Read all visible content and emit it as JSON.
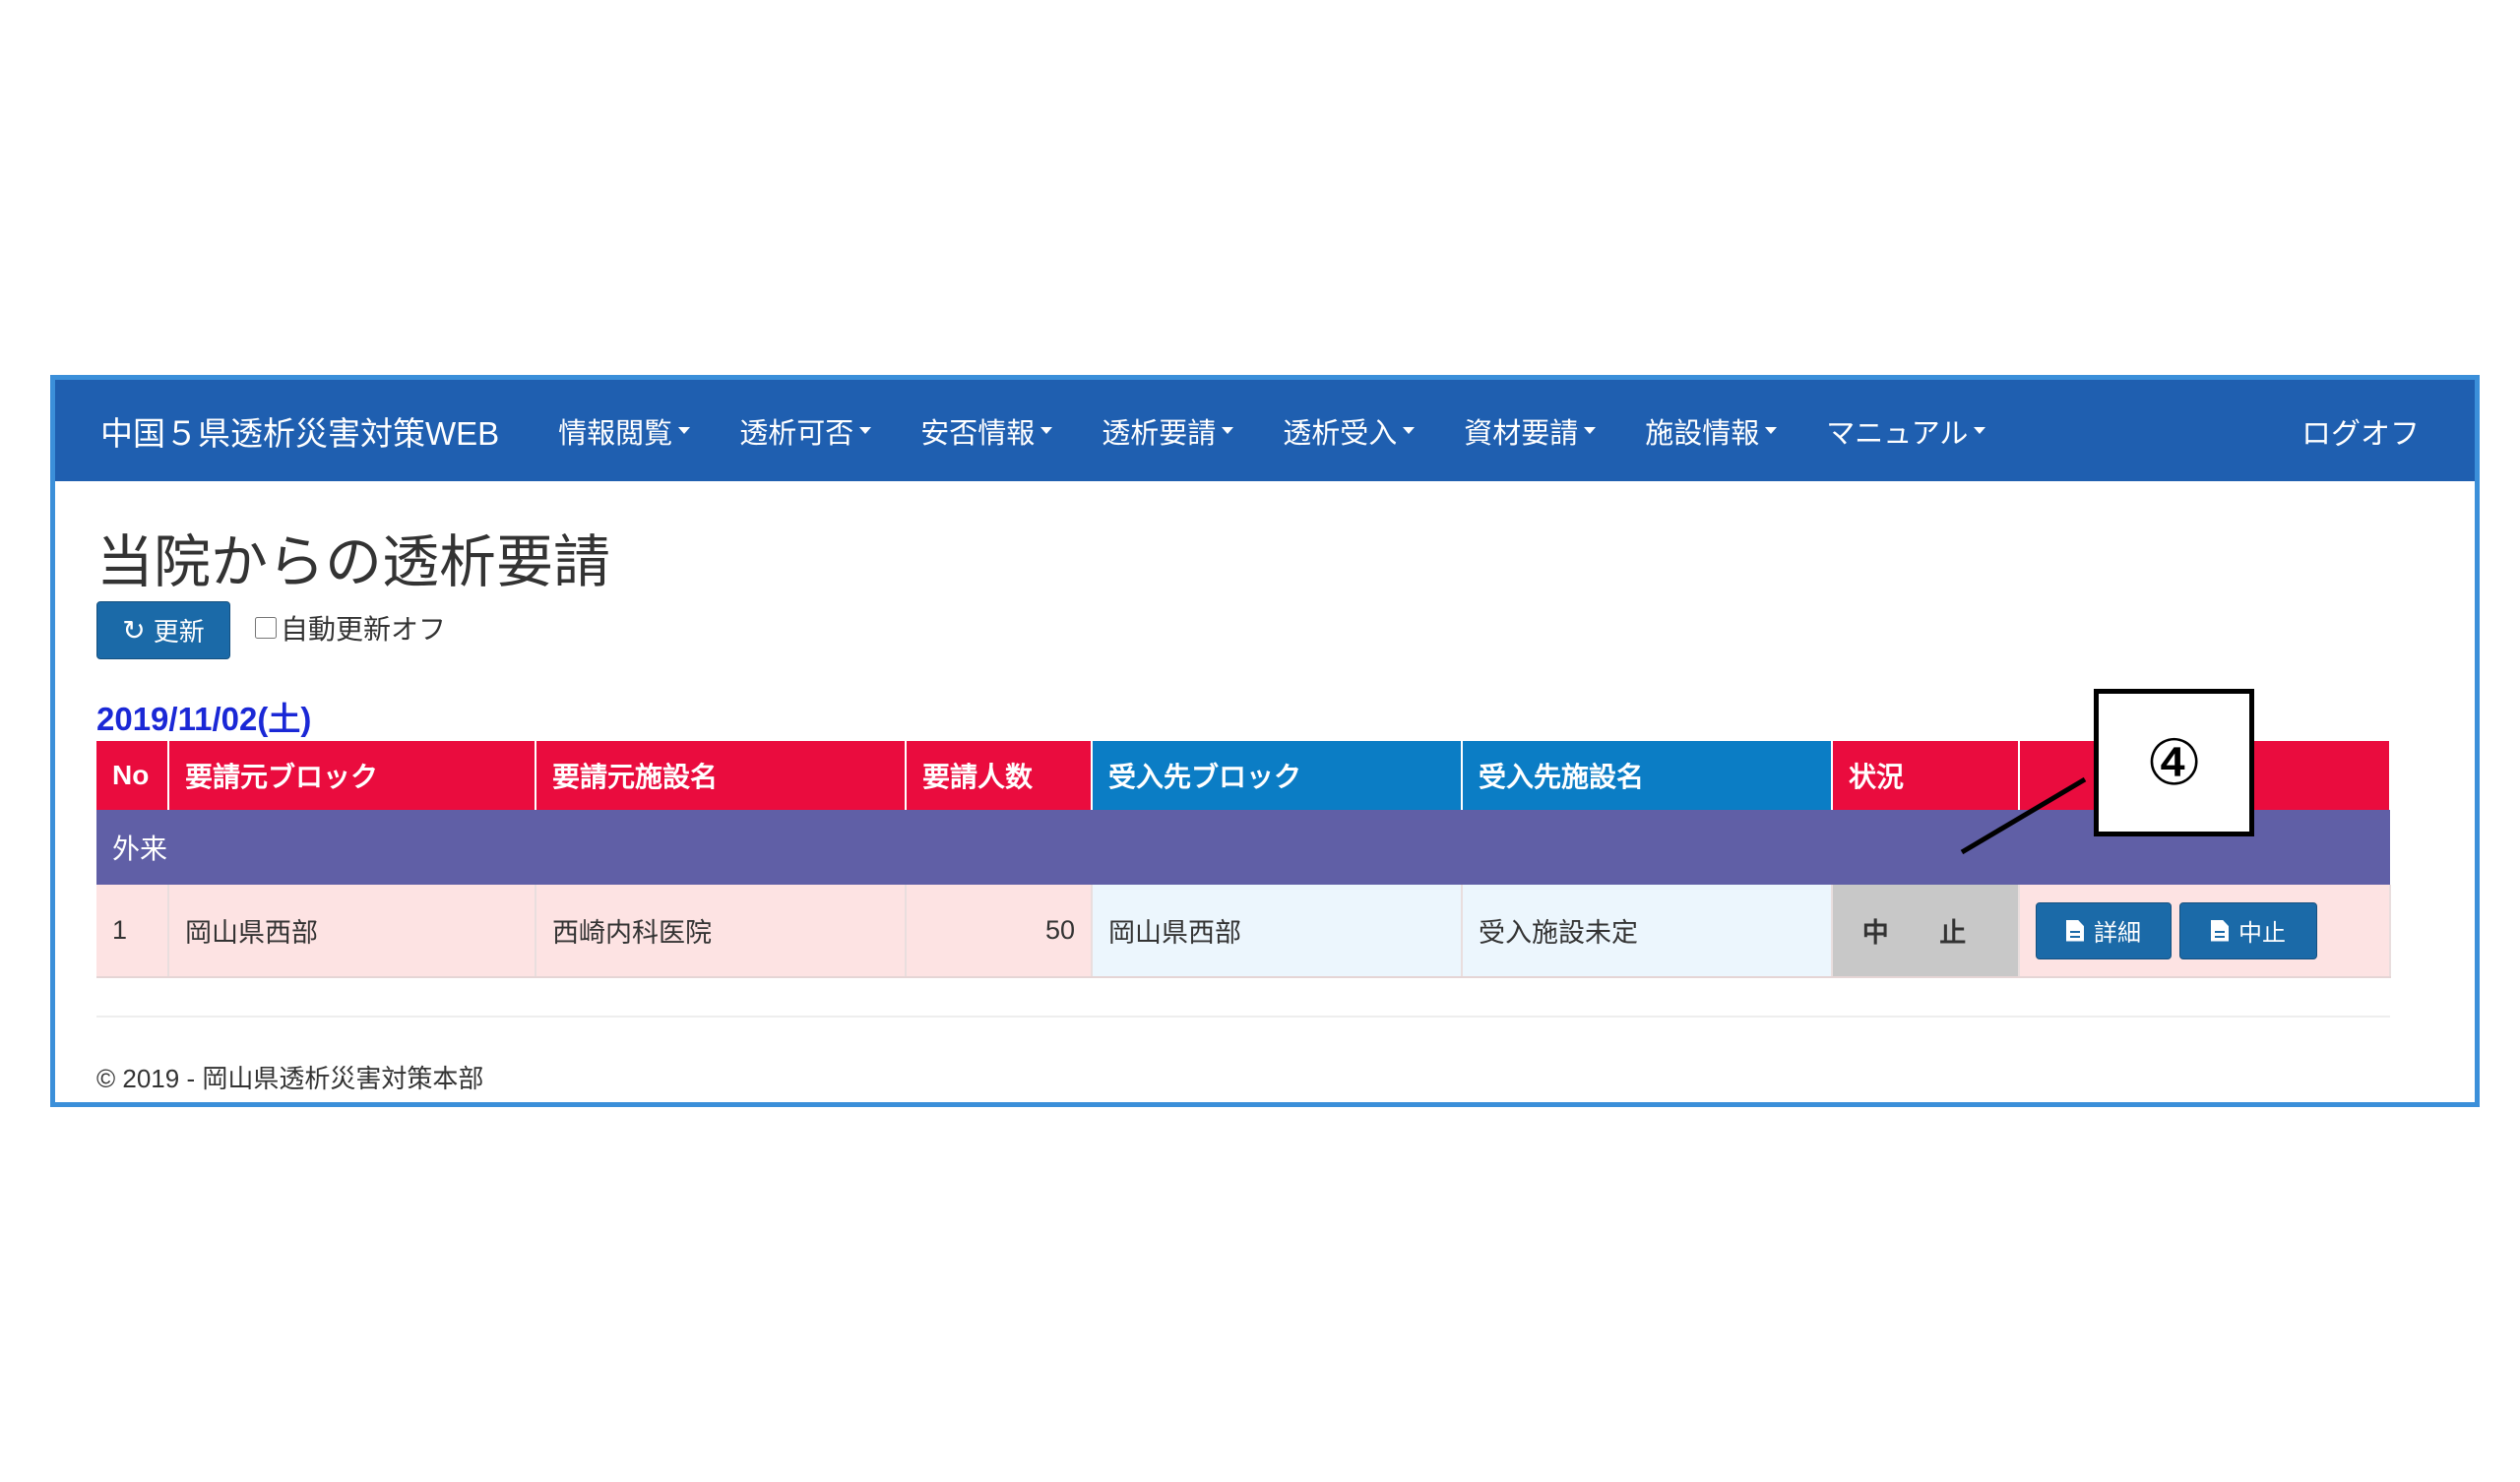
{
  "navbar": {
    "brand": "中国５県透析災害対策WEB",
    "menu": [
      "情報閲覧",
      "透析可否",
      "安否情報",
      "透析要請",
      "透析受入",
      "資材要請",
      "施設情報",
      "マニュアル"
    ],
    "logoff": "ログオフ"
  },
  "page": {
    "title": "当院からの透析要請",
    "refresh_label": "更新",
    "auto_refresh_off_label": "自動更新オフ",
    "date": "2019/11/02(土)"
  },
  "table": {
    "headers": [
      "No",
      "要請元ブロック",
      "要請元施設名",
      "要請人数",
      "受入先ブロック",
      "受入先施設名",
      "状況",
      ""
    ],
    "group": "外来",
    "rows": [
      {
        "no": "1",
        "from_block": "岡山県西部",
        "from_facility": "西崎内科医院",
        "count": "50",
        "to_block": "岡山県西部",
        "to_facility": "受入施設未定",
        "status": "中 止",
        "detail_label": "詳細",
        "cancel_label": "中止"
      }
    ]
  },
  "footer": "© 2019 - 岡山県透析災害対策本部",
  "callout": "④",
  "colors": {
    "navbar": "#1f5fb0",
    "header_red": "#ea0c3e",
    "header_blue": "#0b7dc5",
    "group_purple": "#605fa6",
    "button_blue": "#1b6aa8",
    "date_blue": "#1a28d6"
  }
}
